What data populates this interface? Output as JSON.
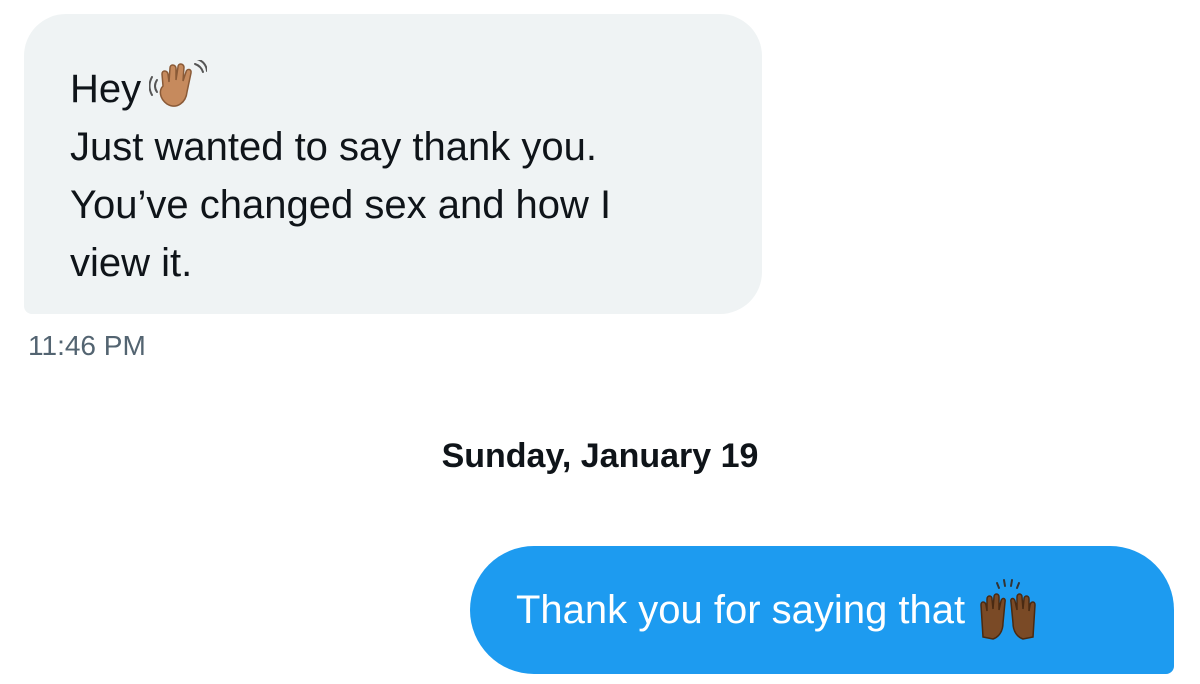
{
  "conversation": {
    "incoming_message": {
      "lines": [
        "Hey",
        "Just wanted to say thank you.",
        "You’ve changed sex and how I",
        "view it."
      ],
      "emoji": "waving-hand-icon",
      "timestamp": "11:46 PM"
    },
    "date_divider": "Sunday, January 19",
    "outgoing_message": {
      "text": "Thank you for saying that",
      "emoji": "raising-hands-icon"
    }
  },
  "colors": {
    "incoming_bubble": "#eff3f4",
    "outgoing_bubble": "#1d9bf0",
    "timestamp_text": "#536471",
    "primary_text": "#0f1419"
  }
}
